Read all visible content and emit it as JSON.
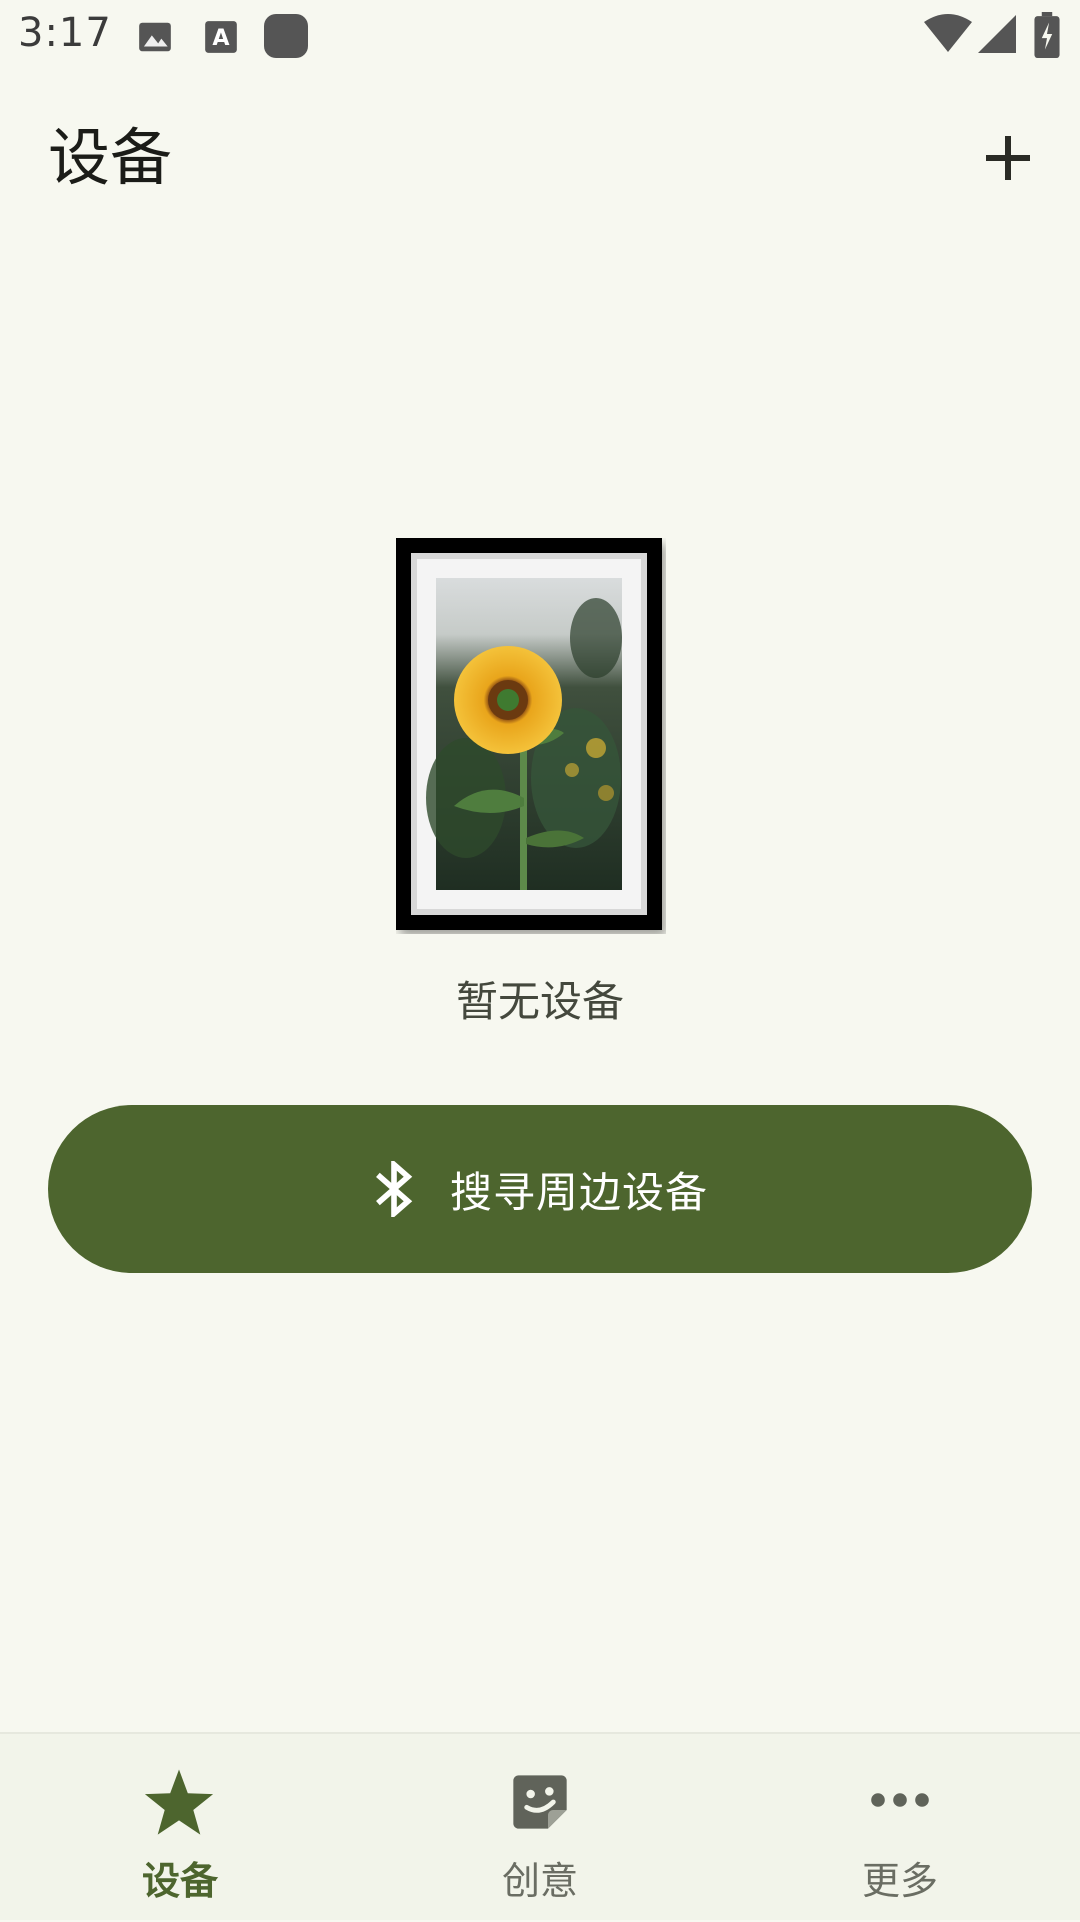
{
  "status_bar": {
    "time": "3:17",
    "icons": [
      "image-icon",
      "text-a-icon",
      "app-square-icon",
      "wifi-icon",
      "signal-icon",
      "battery-charging-icon"
    ]
  },
  "app_bar": {
    "title": "设备",
    "add_icon": "plus-icon"
  },
  "empty_state": {
    "illustration": "framed-sunflower-photo",
    "message": "暂无设备"
  },
  "scan_button": {
    "icon": "bluetooth-icon",
    "label": "搜寻周边设备"
  },
  "bottom_nav": {
    "items": [
      {
        "label": "设备",
        "icon": "star-icon",
        "active": true
      },
      {
        "label": "创意",
        "icon": "sticker-icon",
        "active": false
      },
      {
        "label": "更多",
        "icon": "more-dots-icon",
        "active": false
      }
    ]
  },
  "colors": {
    "background": "#f7f8f0",
    "accent": "#4d652e",
    "nav_background": "#f2f4ea",
    "text_primary": "#1b1c18",
    "text_secondary": "#6a6d63"
  }
}
